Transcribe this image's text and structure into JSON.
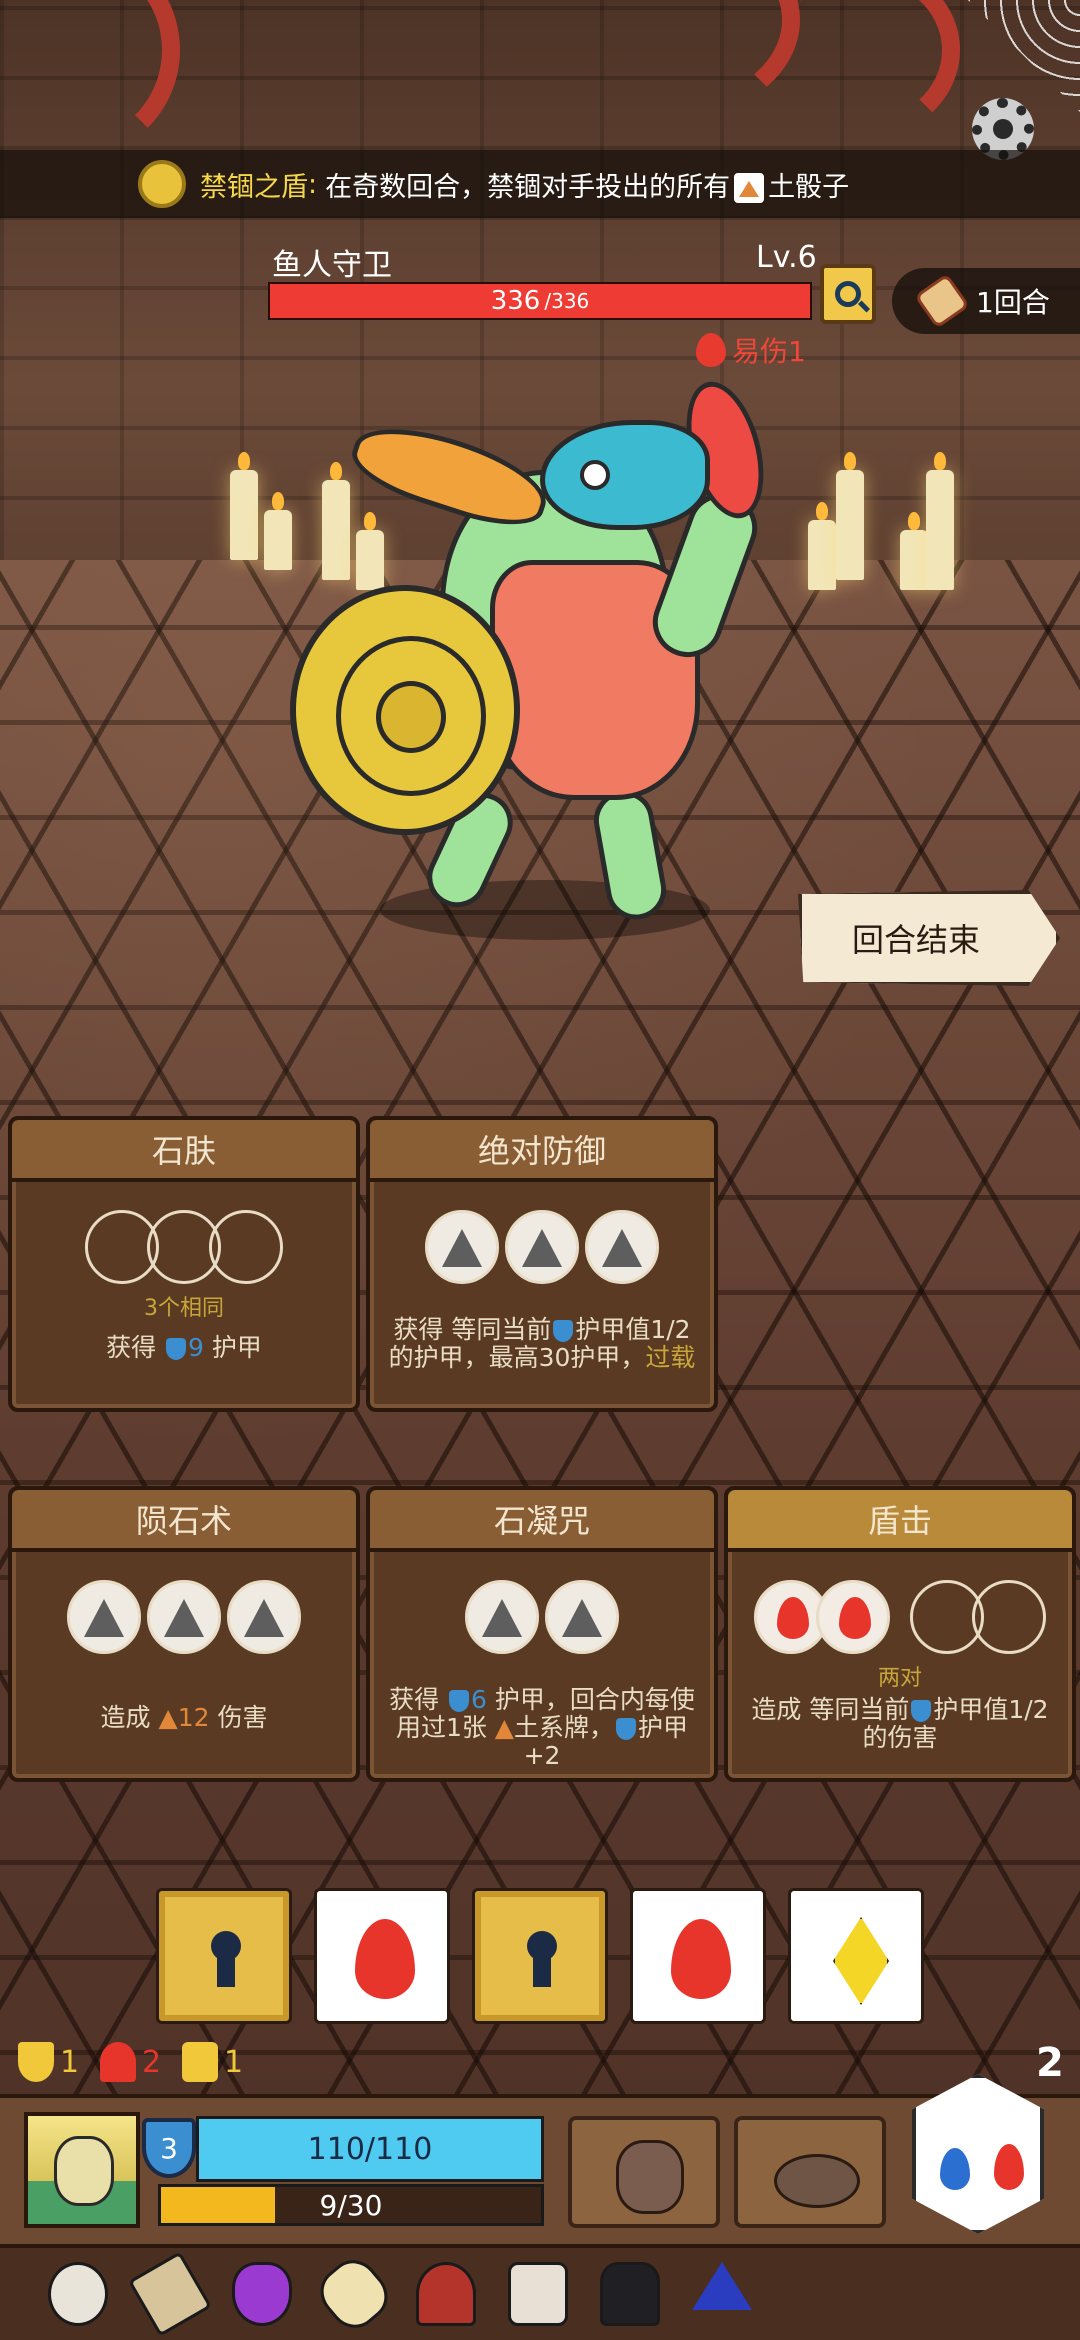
{
  "banner": {
    "title": "禁锢之盾",
    "separator": ":",
    "text_before": "在奇数回合，禁锢对手投出的所有",
    "text_after": "土骰子",
    "coin_icon": "gold-coin-icon",
    "earth_icon": "earth-dice-icon"
  },
  "settings": {
    "icon": "gear-icon"
  },
  "enemy": {
    "name": "鱼人守卫",
    "level": "Lv.6",
    "hp_current": "336",
    "hp_max": "/336",
    "hp_fraction": 1.0,
    "status_label": "易伤1",
    "status_icon": "vulnerable-drop-icon",
    "inspect_icon": "magnifier-icon"
  },
  "round": {
    "label": "1回合",
    "icon": "scroll-icon"
  },
  "end_turn": {
    "label": "回合结束"
  },
  "cards": [
    {
      "title": "石肤",
      "condition": "3个相同",
      "desc_prefix": "获得",
      "desc_value": "9",
      "desc_suffix": "护甲"
    },
    {
      "title": "绝对防御",
      "desc_line1": "获得 等同当前",
      "desc_line1b": "护甲值1/2",
      "desc_line2": "的护甲，最高30护甲，",
      "desc_over": "过载"
    },
    {
      "title": "陨石术",
      "desc_prefix": "造成",
      "desc_value": "12",
      "desc_suffix": "伤害"
    },
    {
      "title": "石凝咒",
      "desc_a": "获得",
      "desc_value": "6",
      "desc_b": "护甲，回合内每使用过1张",
      "desc_c": "土系牌，",
      "desc_d": "护甲+2"
    },
    {
      "title": "盾击",
      "condition": "两对",
      "desc_line1": "造成 等同当前",
      "desc_line1b": "护甲值1/2",
      "desc_line2": "的伤害"
    }
  ],
  "dice": [
    {
      "type": "locked",
      "icon": "lock-icon"
    },
    {
      "type": "fire",
      "icon": "fire-icon"
    },
    {
      "type": "locked",
      "icon": "lock-icon"
    },
    {
      "type": "fire",
      "icon": "fire-icon"
    },
    {
      "type": "gem",
      "icon": "diamond-icon"
    }
  ],
  "stats": {
    "armor": "1",
    "heart": "2",
    "lock": "1",
    "reroll": "2"
  },
  "player": {
    "level": "3",
    "hp": "110/110",
    "xp": "9/30",
    "xp_fraction": 0.3
  },
  "equipment": [
    "spiked-fist-icon",
    "rock-claw-icon"
  ],
  "inventory": [
    "mirror-icon",
    "hammer-icon",
    "potion-icon",
    "flute-icon",
    "helmet-icon",
    "scroll-icon",
    "top-hat-icon",
    "hexagram-icon"
  ],
  "colors": {
    "enemy_hp": "#ee3b33",
    "player_hp": "#4fcaf0",
    "xp": "#f3b81e",
    "gold_text": "#f5d84a",
    "armor_blue": "#3b8ed0",
    "earth_orange": "#e2873a"
  }
}
